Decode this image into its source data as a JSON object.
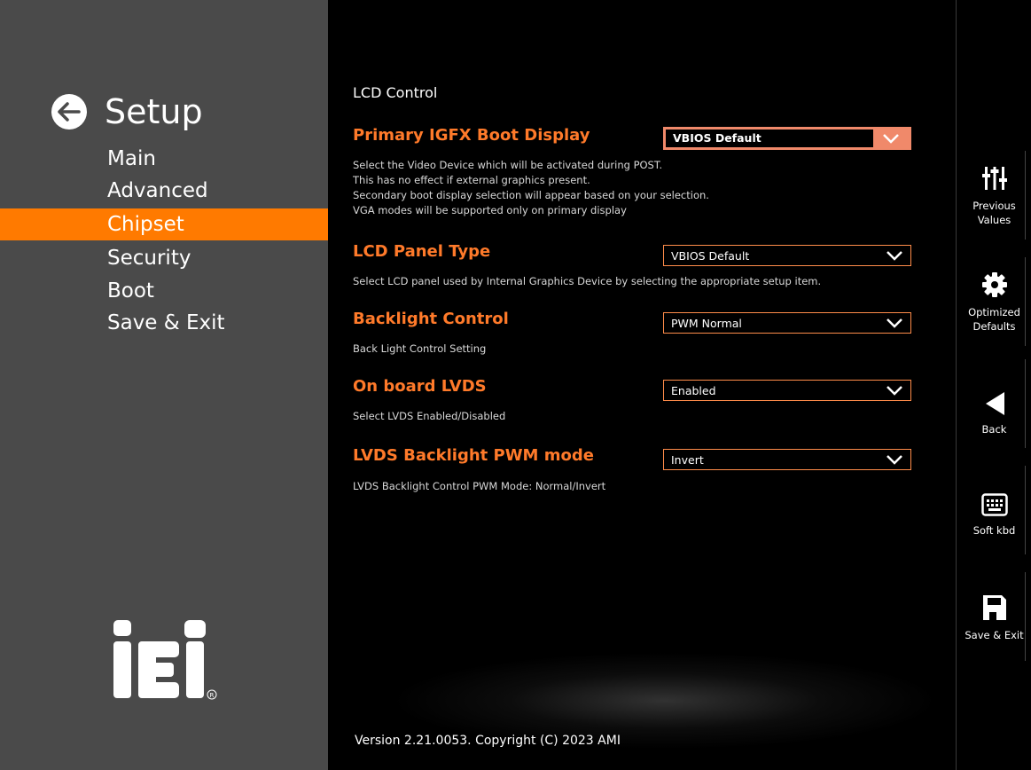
{
  "sidebar": {
    "title": "Setup",
    "items": [
      {
        "label": "Main"
      },
      {
        "label": "Advanced"
      },
      {
        "label": "Chipset"
      },
      {
        "label": "Security"
      },
      {
        "label": "Boot"
      },
      {
        "label": "Save & Exit"
      }
    ],
    "active_item": "Chipset"
  },
  "main": {
    "section_title": "LCD Control",
    "options": [
      {
        "label": "Primary IGFX Boot Display",
        "value": "VBIOS Default",
        "description": [
          "Select the Video Device which will be activated during POST.",
          "This has no effect if external graphics present.",
          "Secondary boot display selection will appear based on your selection.",
          "VGA modes will be supported only on primary display"
        ]
      },
      {
        "label": "LCD Panel Type",
        "value": "VBIOS Default",
        "description": [
          "Select LCD panel used by Internal Graphics Device by selecting the appropriate setup item."
        ]
      },
      {
        "label": "Backlight Control",
        "value": "PWM Normal",
        "description": [
          "Back Light Control Setting"
        ]
      },
      {
        "label": "On board LVDS",
        "value": "Enabled",
        "description": [
          "Select LVDS Enabled/Disabled"
        ]
      },
      {
        "label": "LVDS Backlight PWM mode",
        "value": "Invert",
        "description": [
          "LVDS Backlight Control PWM Mode: Normal/Invert"
        ]
      }
    ],
    "selected_option": "Primary IGFX Boot Display",
    "version": "Version 2.21.0053. Copyright (C) 2023 AMI"
  },
  "toolbar": {
    "previous_values": "Previous Values",
    "optimized_defaults": "Optimized Defaults",
    "back": "Back",
    "soft_kbd": "Soft kbd",
    "save_exit": "Save & Exit"
  },
  "colors": {
    "accent": "#ff7a00",
    "label_orange": "#ff7a2a",
    "selected_box": "#f0896a",
    "sidebar_bg": "#4a4a4a"
  },
  "icons": {
    "back": "arrow-left-icon",
    "previous_values": "sliders-icon",
    "optimized_defaults": "gear-icon",
    "back_tool": "triangle-left-icon",
    "soft_kbd": "keyboard-icon",
    "save_exit": "floppy-disk-icon"
  }
}
